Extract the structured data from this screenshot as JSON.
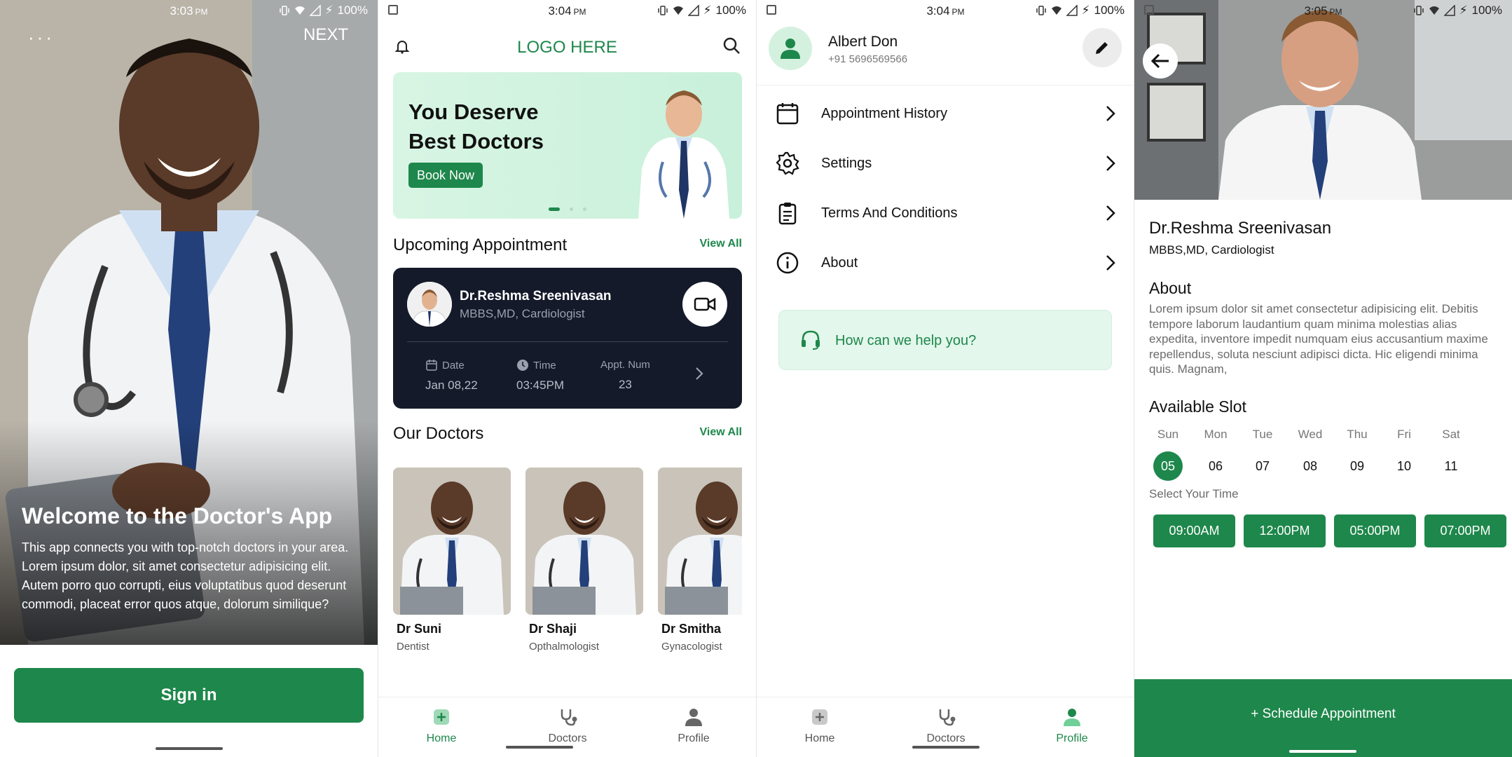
{
  "screens": {
    "welcome": {
      "status": {
        "time": "3:03",
        "ampm": "PM",
        "battery": "100%"
      },
      "menu_dots": "···",
      "next_label": "NEXT",
      "title": "Welcome to the Doctor's App",
      "body": "This app connects you with top-notch doctors in your area. Lorem ipsum dolor, sit amet consectetur adipisicing elit. Autem porro quo corrupti, eius voluptatibus quod deserunt commodi, placeat error quos atque, dolorum similique?",
      "signin_label": "Sign in"
    },
    "home": {
      "status": {
        "time": "3:04",
        "ampm": "PM",
        "battery": "100%"
      },
      "logo": "LOGO HERE",
      "banner": {
        "title": "You Deserve Best Doctors",
        "button": "Book Now",
        "pages": 3,
        "active_page": 0
      },
      "upcoming": {
        "title": "Upcoming Appointment",
        "view_all": "View All",
        "doctor_name": "Dr.Reshma Sreenivasan",
        "doctor_degree": "MBBS,MD, Cardiologist",
        "date_label": "Date",
        "date_value": "Jan 08,22",
        "time_label": "Time",
        "time_value": "03:45PM",
        "appt_label": "Appt. Num",
        "appt_value": "23"
      },
      "our_doctors": {
        "title": "Our Doctors",
        "view_all": "View All",
        "doctors": [
          {
            "name": "Dr Suni",
            "specialty": "Dentist"
          },
          {
            "name": "Dr Shaji",
            "specialty": "Opthalmologist"
          },
          {
            "name": "Dr Smitha",
            "specialty": "Gynacologist"
          }
        ]
      },
      "nav": [
        {
          "label": "Home",
          "icon": "home-plus-icon",
          "active": true
        },
        {
          "label": "Doctors",
          "icon": "stethoscope-icon",
          "active": false
        },
        {
          "label": "Profile",
          "icon": "person-icon",
          "active": false
        }
      ]
    },
    "profile": {
      "status": {
        "time": "3:04",
        "ampm": "PM",
        "battery": "100%"
      },
      "user_name": "Albert Don",
      "phone": "+91 5696569566",
      "menu": [
        {
          "label": "Appointment History",
          "icon": "calendar-icon"
        },
        {
          "label": "Settings",
          "icon": "gear-icon"
        },
        {
          "label": "Terms And Conditions",
          "icon": "clipboard-icon"
        },
        {
          "label": "About",
          "icon": "info-icon"
        }
      ],
      "help": "How can we help you?",
      "nav": [
        {
          "label": "Home",
          "icon": "home-plus-icon",
          "active": false
        },
        {
          "label": "Doctors",
          "icon": "stethoscope-icon",
          "active": false
        },
        {
          "label": "Profile",
          "icon": "person-icon",
          "active": true
        }
      ]
    },
    "detail": {
      "status": {
        "time": "3:05",
        "ampm": "PM",
        "battery": "100%"
      },
      "doctor_name": "Dr.Reshma Sreenivasan",
      "degree": "MBBS,MD, Cardiologist",
      "about_title": "About",
      "about_text": "Lorem ipsum dolor sit amet consectetur adipisicing elit. Debitis tempore laborum laudantium quam minima molestias alias expedita, inventore impedit numquam eius accusantium maxime repellendus, soluta nesciunt adipisci dicta. Hic eligendi minima quis. Magnam,",
      "slot_title": "Available Slot",
      "days": [
        {
          "name": "Sun",
          "date": "05",
          "selected": true
        },
        {
          "name": "Mon",
          "date": "06",
          "selected": false
        },
        {
          "name": "Tue",
          "date": "07",
          "selected": false
        },
        {
          "name": "Wed",
          "date": "08",
          "selected": false
        },
        {
          "name": "Thu",
          "date": "09",
          "selected": false
        },
        {
          "name": "Fri",
          "date": "10",
          "selected": false
        },
        {
          "name": "Sat",
          "date": "11",
          "selected": false
        }
      ],
      "select_time": "Select Your Time",
      "times": [
        "09:00AM",
        "12:00PM",
        "05:00PM",
        "07:00PM"
      ],
      "schedule_button": "+ Schedule Appointment"
    }
  },
  "colors": {
    "brand_green": "#1e874b",
    "dark_card": "#141a2a",
    "mint": "#d8f5e4"
  }
}
